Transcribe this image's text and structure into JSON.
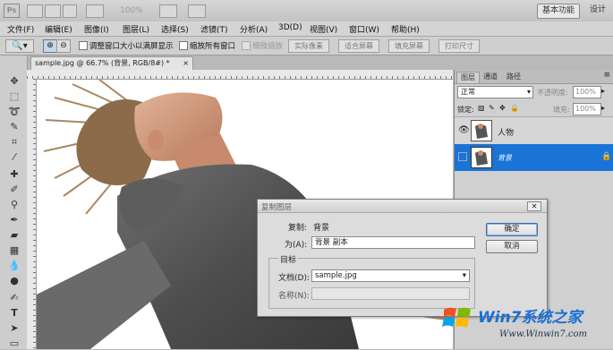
{
  "appbar": {
    "logo": "Ps",
    "zoom": "100%",
    "zoom2": "100%",
    "workspace_active": "基本功能",
    "workspace_other": "设计"
  },
  "menu": [
    "文件(F)",
    "编辑(E)",
    "图像(I)",
    "图层(L)",
    "选择(S)",
    "滤镜(T)",
    "分析(A)",
    "3D(D)",
    "视图(V)",
    "窗口(W)",
    "帮助(H)"
  ],
  "options": {
    "resize_windows": "调整窗口大小以满屏显示",
    "zoom_all": "缩放所有窗口",
    "scrubby": "细微缩放",
    "actual_pixels": "实际像素",
    "fit_screen": "适合屏幕",
    "fill_screen": "填充屏幕",
    "print_size": "打印尺寸"
  },
  "document": {
    "tab": "sample.jpg @ 66.7% (背景, RGB/8#) *",
    "close": "×"
  },
  "panel": {
    "tabs": [
      "图层",
      "通道",
      "路径"
    ],
    "blend_mode": "正常",
    "opacity_label": "不透明度:",
    "opacity": "100%",
    "lock_label": "锁定:",
    "fill_label": "填充:",
    "fill": "100%",
    "layers": [
      {
        "name": "人物",
        "selected": false
      },
      {
        "name": "背景",
        "selected": true
      }
    ]
  },
  "dialog": {
    "title": "复制图层",
    "copy_label": "复制:",
    "copy_value": "背景",
    "as_label": "为(A):",
    "as_value": "背景 副本",
    "target_label": "目标",
    "doc_label": "文档(D):",
    "doc_value": "sample.jpg",
    "name_label": "名称(N):",
    "name_value": "",
    "ok": "确定",
    "cancel": "取消"
  },
  "watermark": {
    "brand": "Win7系统之家",
    "url": "Www.Winwin7.com"
  },
  "colors": {
    "selection": "#1a73d6",
    "accent": "#1b6fd1"
  }
}
